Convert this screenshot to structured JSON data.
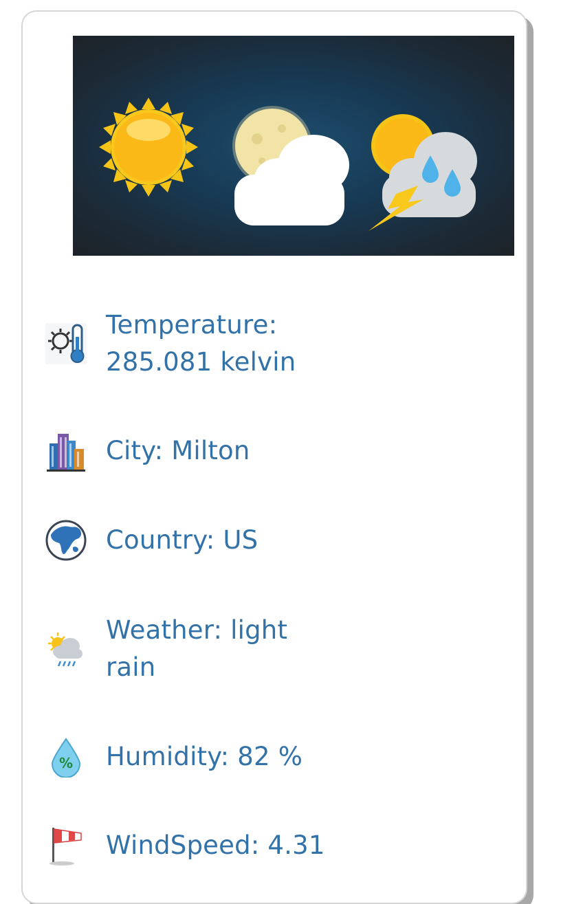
{
  "banner": {
    "icons": [
      "sun-icon",
      "moon-cloud-icon",
      "storm-cloud-icon"
    ]
  },
  "rows": [
    {
      "icon": "thermometer-icon",
      "line1": "Temperature:",
      "line2": "285.081 kelvin"
    },
    {
      "icon": "city-buildings-icon",
      "text": "City: Milton"
    },
    {
      "icon": "globe-icon",
      "text": "Country: US"
    },
    {
      "icon": "rain-cloud-icon",
      "line1": "Weather: light",
      "line2": "rain"
    },
    {
      "icon": "humidity-drop-icon",
      "text": "Humidity: 82 %"
    },
    {
      "icon": "windsock-icon",
      "text": "WindSpeed: 4.31"
    }
  ],
  "colors": {
    "text": "#3272a8",
    "banner_bg": "#173a55"
  }
}
